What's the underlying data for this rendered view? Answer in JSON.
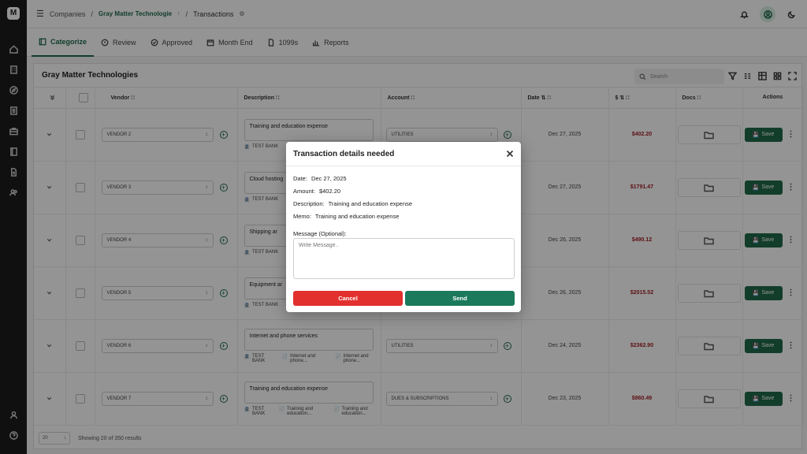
{
  "breadcrumb": {
    "root": "Companies",
    "company": "Gray Matter Technologie",
    "page": "Transactions"
  },
  "tabs": [
    {
      "label": "Categorize",
      "icon": "categorize-icon"
    },
    {
      "label": "Review",
      "icon": "review-icon"
    },
    {
      "label": "Approved",
      "icon": "approved-icon"
    },
    {
      "label": "Month End",
      "icon": "calendar-icon"
    },
    {
      "label": "1099s",
      "icon": "document-icon"
    },
    {
      "label": "Reports",
      "icon": "chart-icon"
    }
  ],
  "panel": {
    "title": "Gray Matter Technologies",
    "search_placeholder": "Search"
  },
  "columns": {
    "vendor": "Vendor",
    "description": "Description",
    "account": "Account",
    "date": "Date",
    "amount": "$",
    "docs": "Docs",
    "actions": "Actions"
  },
  "rows": [
    {
      "vendor": "VENDOR 2",
      "description": "Training and education expense",
      "bank": "TEST BANK",
      "account": "UTILITIES",
      "date": "Dec 27, 2025",
      "amount": "$402.20",
      "save": "Save"
    },
    {
      "vendor": "VENDOR 3",
      "description": "Cloud hosting",
      "bank": "TEST BANK",
      "account": "",
      "date": "Dec 27, 2025",
      "amount": "$1791.47",
      "save": "Save"
    },
    {
      "vendor": "VENDOR 4",
      "description": "Shipping ar",
      "bank": "TEST BANK",
      "account": "",
      "date": "Dec 26, 2025",
      "amount": "$490.12",
      "save": "Save"
    },
    {
      "vendor": "VENDOR 5",
      "description": "Equipment ar",
      "bank": "TEST BANK",
      "account": "",
      "date": "Dec 26, 2025",
      "amount": "$2015.52",
      "save": "Save"
    },
    {
      "vendor": "VENDOR 6",
      "description": "Internet and phone services",
      "bank": "TEST BANK",
      "attach1": "Internet and phone...",
      "attach2": "Internet and phone...",
      "account": "UTILITIES",
      "date": "Dec 24, 2025",
      "amount": "$2362.90",
      "save": "Save"
    },
    {
      "vendor": "VENDOR 7",
      "description": "Training and education expense",
      "bank": "TEST BANK",
      "attach1": "Training and education...",
      "attach2": "Training and education...",
      "account": "DUES & SUBSCRIPTIONS",
      "date": "Dec 23, 2025",
      "amount": "$860.49",
      "save": "Save"
    }
  ],
  "footer": {
    "page_size": "20",
    "results": "Showing 20 of 350 results"
  },
  "modal": {
    "title": "Transaction details needed",
    "date_label": "Date:",
    "date_value": "Dec 27, 2025",
    "amount_label": "Amount:",
    "amount_value": "$402.20",
    "description_label": "Description:",
    "description_value": "Training and education expense",
    "memo_label": "Memo:",
    "memo_value": "Training and education expense",
    "message_label": "Message (Optional):",
    "message_placeholder": "Write Message..",
    "cancel": "Cancel",
    "send": "Send"
  },
  "colors": {
    "brand_green": "#1f6a4a",
    "send_green": "#1b7a5c",
    "cancel_red": "#e2302f",
    "amount_red": "#a11f25"
  }
}
